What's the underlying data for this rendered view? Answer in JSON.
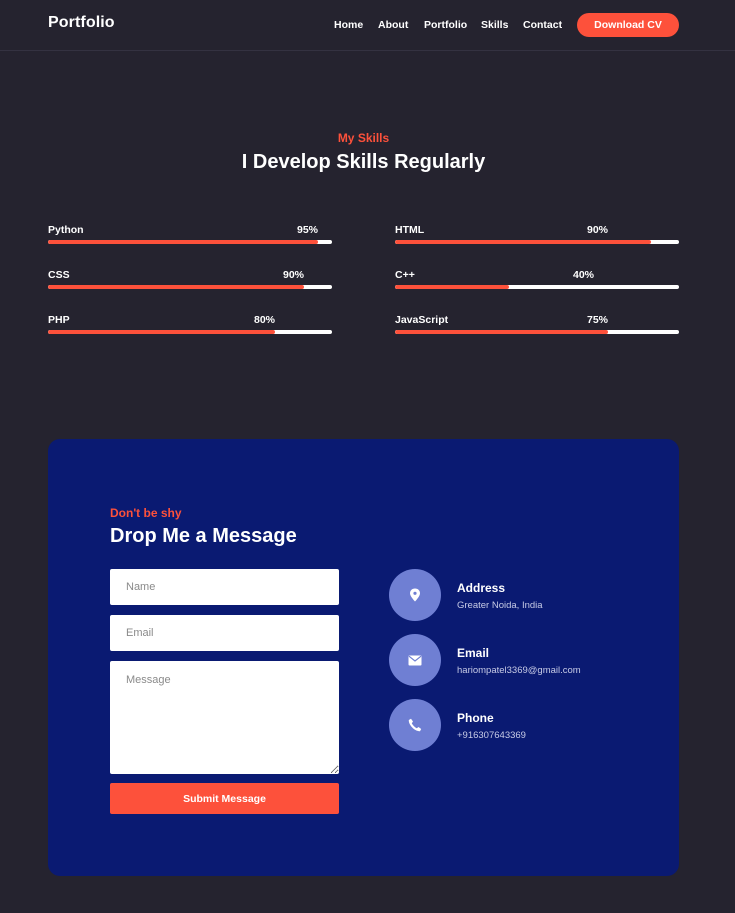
{
  "nav": {
    "logo": "Portfolio",
    "links": [
      "Home",
      "About",
      "Portfolio",
      "Skills",
      "Contact"
    ],
    "download_cv": "Download CV"
  },
  "skills": {
    "subtitle": "My Skills",
    "title": "I Develop Skills Regularly",
    "items": [
      {
        "name": "Python",
        "percent_label": "95%",
        "level": 0.95
      },
      {
        "name": "HTML",
        "percent_label": "90%",
        "level": 0.9
      },
      {
        "name": "CSS",
        "percent_label": "90%",
        "level": 0.9
      },
      {
        "name": "C++",
        "percent_label": "40%",
        "level": 0.4
      },
      {
        "name": "PHP",
        "percent_label": "80%",
        "level": 0.8
      },
      {
        "name": "JavaScript",
        "percent_label": "75%",
        "level": 0.75
      }
    ]
  },
  "contact": {
    "subtitle": "Don't be shy",
    "title": "Drop Me a Message",
    "name_placeholder": "Name",
    "email_placeholder": "Email",
    "message_placeholder": "Message",
    "submit": "Submit Message",
    "info": [
      {
        "label": "Address",
        "value": "Greater Noida, India",
        "icon": "location-pin-icon"
      },
      {
        "label": "Email",
        "value": "hariompatel3369@gmail.com",
        "icon": "envelope-icon"
      },
      {
        "label": "Phone",
        "value": "+916307643369",
        "icon": "phone-icon"
      }
    ]
  },
  "colors": {
    "background": "#25232f",
    "accent": "#fd513b",
    "card": "#0a1a72",
    "icon_circle": "#6f7fd3"
  }
}
